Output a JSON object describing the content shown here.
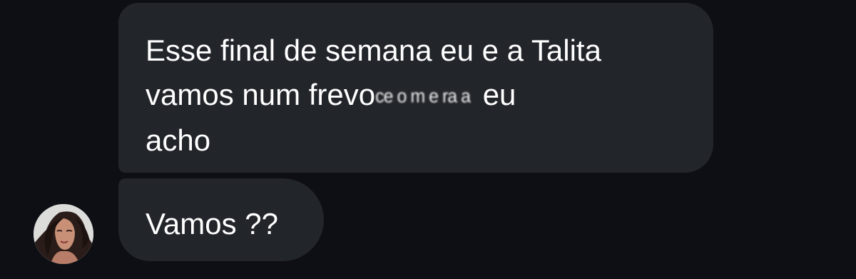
{
  "colors": {
    "background": "#0d0f14",
    "bubble": "#22252a",
    "text": "#ffffff"
  },
  "messages": [
    {
      "line1": "Esse final de semana eu e a Talita",
      "line2_start": "vamos num frevo",
      "line2_obscured": "ce o m e ra a",
      "line2_end": " eu",
      "line3": "acho"
    },
    {
      "text": "Vamos ??"
    }
  ],
  "sender": {
    "avatar_icon": "avatar-photo-icon"
  }
}
